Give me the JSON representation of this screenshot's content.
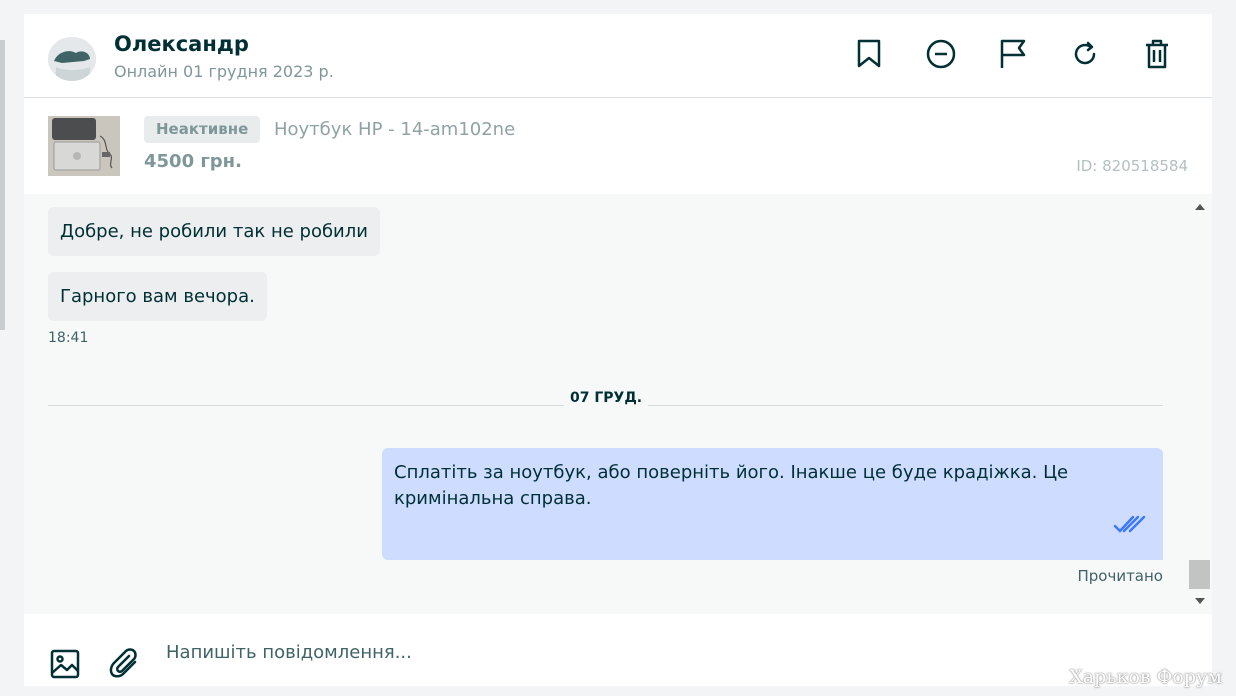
{
  "header": {
    "contact_name": "Олександр",
    "contact_status": "Онлайн 01 грудня 2023 р."
  },
  "ad": {
    "status_badge": "Неактивне",
    "title": "Ноутбук HP - 14-am102ne",
    "price": "4500 грн.",
    "id_label": "ID: 820518584"
  },
  "messages": {
    "incoming": [
      {
        "text": "Добре, не робили так не робили"
      },
      {
        "text": "Гарного вам вечора."
      }
    ],
    "incoming_time": "18:41",
    "date_divider": "07 ГРУД.",
    "outgoing": {
      "text": "Сплатіть за ноутбук, або поверніть його. Інакше це буде крадіжка. Це кримінальна справа.",
      "read_label": "Прочитано"
    }
  },
  "composer": {
    "placeholder": "Напишіть повідомлення..."
  },
  "watermark": "Харьков Форум",
  "colors": {
    "text_primary": "#002f34",
    "outgoing_bubble": "#cddcff",
    "incoming_bubble": "#eceeef",
    "read_checks": "#3a77ff"
  },
  "icons": {
    "header": [
      "bookmark-icon",
      "block-icon",
      "flag-icon",
      "refresh-icon",
      "trash-icon"
    ],
    "composer": [
      "image-icon",
      "attachment-icon"
    ]
  }
}
